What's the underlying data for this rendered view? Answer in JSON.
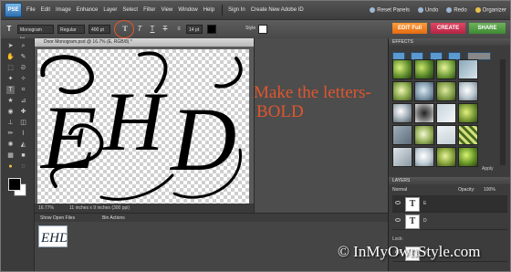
{
  "app": {
    "logo": "PSE"
  },
  "menu": [
    "File",
    "Edit",
    "Image",
    "Enhance",
    "Layer",
    "Select",
    "Filter",
    "View",
    "Window",
    "Help"
  ],
  "account": {
    "sign_in": "Sign In",
    "create_id": "Create New Adobe ID"
  },
  "quick": {
    "reset_panels": "Reset Panels",
    "undo": "Undo",
    "redo": "Redo",
    "organizer": "Organizer"
  },
  "options": {
    "font_family": "Monogram Ini...",
    "font_style": "Regular",
    "font_size": "400 pt",
    "leading": "14 pt",
    "style_label": "Style"
  },
  "modes": {
    "edit": "EDIT Full",
    "create": "CREATE",
    "share": "SHARE"
  },
  "document": {
    "tab_title": "Door Monogram.psd @ 16.7% (E, RGB/8) *",
    "monogram_text": "EHD",
    "zoom": "16.77%",
    "size_info": "11 inches x 9 inches (300 ppi)"
  },
  "annotation": {
    "line1": "Make the letters-",
    "line2": "BOLD"
  },
  "project_bin": {
    "show_open_files": "Show Open Files",
    "bin_actions": "Bin Actions"
  },
  "effects_panel": {
    "title": "EFFECTS",
    "apply": "Apply"
  },
  "layers_panel": {
    "title": "LAYERS",
    "blend_mode": "Normal",
    "opacity_label": "Opacity:",
    "opacity_value": "100%",
    "lock_label": "Lock:",
    "rows": [
      {
        "thumb": "T",
        "name": "E"
      },
      {
        "thumb": "T",
        "name": "D"
      },
      {
        "thumb": "T",
        "name": "H"
      }
    ]
  },
  "watermark": "© InMyOwnStyle.com",
  "colors": {
    "annotation": "#e0562d",
    "edit_button": "#f28a2b",
    "create_button": "#d23a58",
    "share_button": "#5aa34b"
  }
}
